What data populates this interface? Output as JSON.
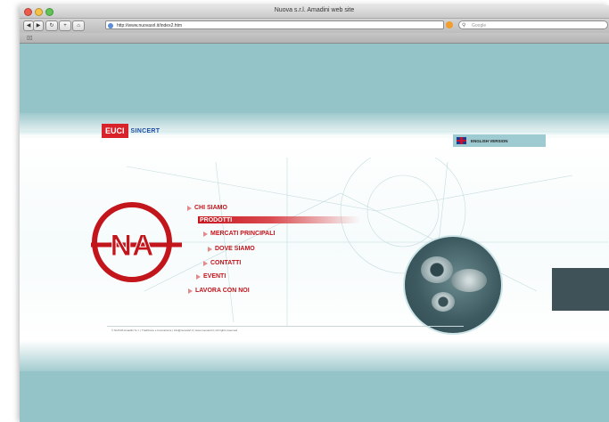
{
  "window": {
    "title": "Nuova s.r.l. Amadini web site",
    "url": "http://www.nuovasrl.it/index2.htm",
    "search_placeholder": "Google"
  },
  "header": {
    "brand_box": "EUCI",
    "brand_text": "SINCERT",
    "english_label": "ENGLISH VERSION"
  },
  "menu": {
    "items": [
      {
        "label": "CHI SIAMO"
      },
      {
        "label": "PRODOTTI"
      },
      {
        "label": "MERCATI PRINCIPALI"
      },
      {
        "label": "DOVE SIAMO"
      },
      {
        "label": "CONTATTI"
      },
      {
        "label": "EVENTI"
      },
      {
        "label": "LAVORA CON NOI"
      }
    ]
  },
  "logo": {
    "text": "NA"
  },
  "footer": {
    "text": "© NUOVA Amadini S.r.l. | Tradizione e Innovazione | info@nuovasrl.it | www.nuovasrl.it | All rights reserved"
  },
  "colors": {
    "brand_red": "#c2151c",
    "brand_blue": "#1d4ea6",
    "teal": "#94c3c8"
  }
}
